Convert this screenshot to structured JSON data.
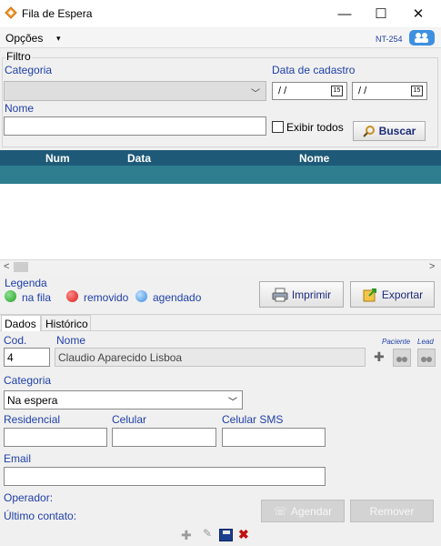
{
  "window": {
    "title": "Fila de Espera",
    "minimize": "—",
    "maximize": "☐",
    "close": "✕"
  },
  "menu": {
    "opcoes": "Opções",
    "arrow": "▾",
    "version": "NT-254"
  },
  "filter": {
    "group_title": "Filtro",
    "categoria_label": "Categoria",
    "data_cadastro_label": "Data de cadastro",
    "date_from": " / /",
    "date_to": " / /",
    "cal_glyph": "15",
    "nome_label": "Nome",
    "exibir_todos": "Exibir todos",
    "buscar": "Buscar"
  },
  "grid": {
    "columns": [
      "Num",
      "Data",
      "Nome"
    ]
  },
  "legend": {
    "title": "Legenda",
    "items": [
      {
        "label": "na fila",
        "color": "#22a02a"
      },
      {
        "label": "removido",
        "color": "#d81818"
      },
      {
        "label": "agendado",
        "color": "#3a8ae0"
      }
    ],
    "imprimir": "Imprimir",
    "exportar": "Exportar"
  },
  "tabs": [
    "Dados",
    "Histórico"
  ],
  "form": {
    "cod_label": "Cod.",
    "cod_value": "4",
    "nome_label": "Nome",
    "nome_value": "Claudio Aparecido Lisboa",
    "paciente": "Paciente",
    "lead": "Lead",
    "categoria_label": "Categoria",
    "categoria_value": "Na espera",
    "residencial_label": "Residencial",
    "celular_label": "Celular",
    "celular_sms_label": "Celular SMS",
    "email_label": "Email",
    "operador_label": "Operador:",
    "ultimo_contato_label": "Último contato:",
    "agendar": "Agendar",
    "remover": "Remover"
  },
  "icons": {
    "scroll_left": "<",
    "scroll_right": ">",
    "add": "✚",
    "edit": "✎",
    "save": "■",
    "delete": "✖"
  }
}
